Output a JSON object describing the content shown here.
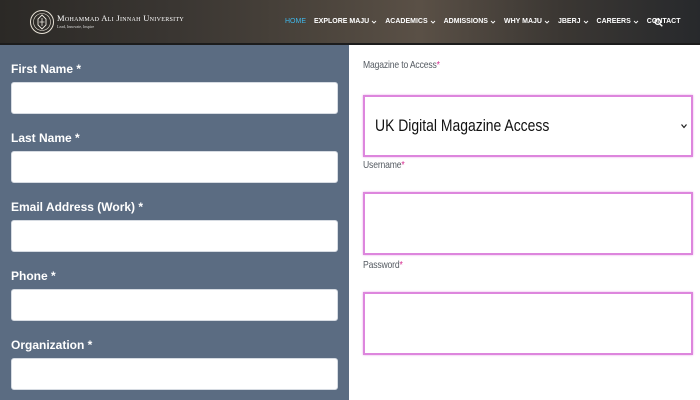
{
  "nav": {
    "brand_name": "Mohammad Ali Jinnah University",
    "brand_tagline": "Lead, Innovate, Inspire",
    "items": [
      {
        "label": "HOME",
        "active": true,
        "dropdown": false
      },
      {
        "label": "EXPLORE MAJU",
        "active": false,
        "dropdown": true
      },
      {
        "label": "ACADEMICS",
        "active": false,
        "dropdown": true
      },
      {
        "label": "ADMISSIONS",
        "active": false,
        "dropdown": true
      },
      {
        "label": "WHY MAJU",
        "active": false,
        "dropdown": true
      },
      {
        "label": "JBERJ",
        "active": false,
        "dropdown": true
      },
      {
        "label": "CAREERS",
        "active": false,
        "dropdown": true
      },
      {
        "label": "CONTACT",
        "active": false,
        "dropdown": false
      }
    ],
    "search_icon": "search-icon",
    "active_color": "#3fb7ea"
  },
  "left_form": {
    "background_color": "#5b6c82",
    "fields": [
      {
        "label": "First Name *",
        "value": ""
      },
      {
        "label": "Last Name *",
        "value": ""
      },
      {
        "label": "Email Address (Work) *",
        "value": ""
      },
      {
        "label": "Phone *",
        "value": ""
      },
      {
        "label": "Organization *",
        "value": ""
      }
    ]
  },
  "right_form": {
    "magazine": {
      "label": "Magazine to Access",
      "required_mark": "*",
      "selected": "UK Digital Magazine Access"
    },
    "username": {
      "label": "Username",
      "required_mark": "*",
      "value": ""
    },
    "password": {
      "label": "Password",
      "required_mark": "*",
      "value": ""
    },
    "focus_border_color": "#dd86dd",
    "required_color": "#d52b8f"
  }
}
